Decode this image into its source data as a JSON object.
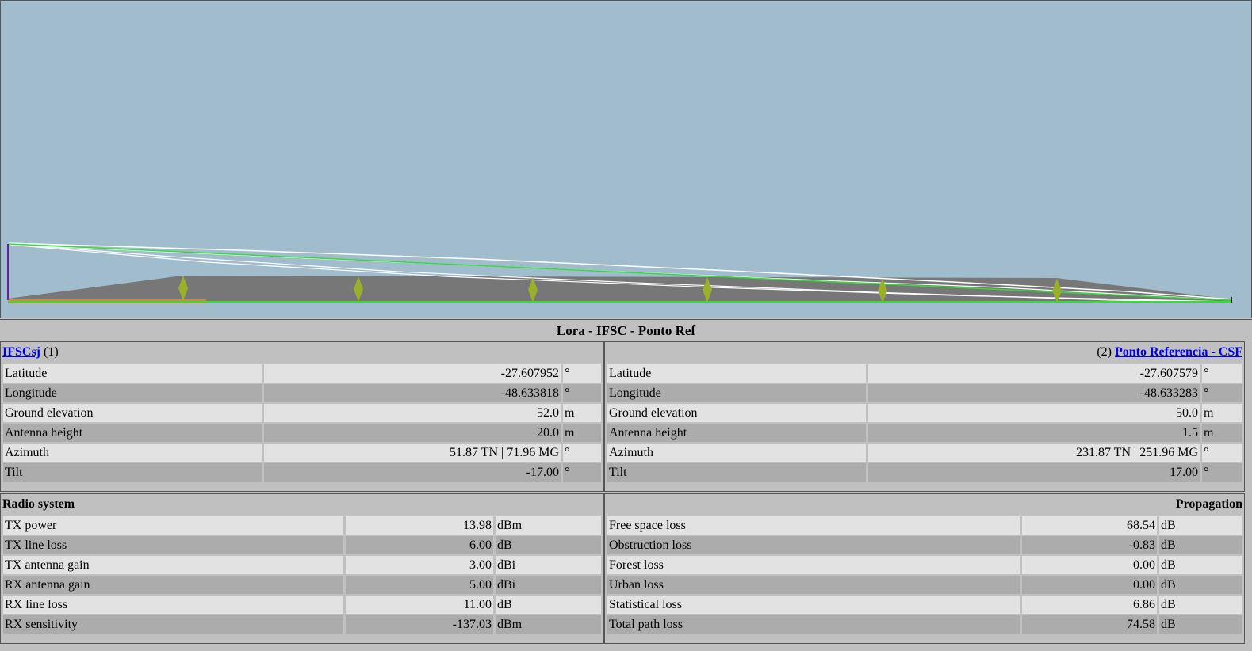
{
  "profile": {
    "sky_color": "#a0bccd",
    "terrain_color": "#777777",
    "ground_color": "#d08a3a",
    "fresnel_color": "#ffffff",
    "los_color": "#33dd33",
    "marker_color": "#9aaf2a",
    "tx_mast_color": "#6a1fa0"
  },
  "link_title": "Lora - IFSC - Ponto Ref",
  "site1": {
    "name": "IFSCsj",
    "index": "(1)",
    "rows": [
      {
        "label": "Latitude",
        "value": "-27.607952",
        "unit": "°"
      },
      {
        "label": "Longitude",
        "value": "-48.633818",
        "unit": "°"
      },
      {
        "label": "Ground elevation",
        "value": "52.0",
        "unit": "m"
      },
      {
        "label": "Antenna height",
        "value": "20.0",
        "unit": "m"
      },
      {
        "label": "Azimuth",
        "value": "51.87 TN | 71.96 MG",
        "unit": "°"
      },
      {
        "label": "Tilt",
        "value": "-17.00",
        "unit": "°"
      }
    ]
  },
  "site2": {
    "name": "Ponto Referencia - CSF",
    "index": "(2)",
    "rows": [
      {
        "label": "Latitude",
        "value": "-27.607579",
        "unit": "°"
      },
      {
        "label": "Longitude",
        "value": "-48.633283",
        "unit": "°"
      },
      {
        "label": "Ground elevation",
        "value": "50.0",
        "unit": "m"
      },
      {
        "label": "Antenna height",
        "value": "1.5",
        "unit": "m"
      },
      {
        "label": "Azimuth",
        "value": "231.87 TN | 251.96 MG",
        "unit": "°"
      },
      {
        "label": "Tilt",
        "value": "17.00",
        "unit": "°"
      }
    ]
  },
  "radio": {
    "heading": "Radio system",
    "rows": [
      {
        "label": "TX power",
        "value": "13.98",
        "unit": "dBm"
      },
      {
        "label": "TX line loss",
        "value": "6.00",
        "unit": "dB"
      },
      {
        "label": "TX antenna gain",
        "value": "3.00",
        "unit": "dBi"
      },
      {
        "label": "RX antenna gain",
        "value": "5.00",
        "unit": "dBi"
      },
      {
        "label": "RX line loss",
        "value": "11.00",
        "unit": "dB"
      },
      {
        "label": "RX sensitivity",
        "value": "-137.03",
        "unit": "dBm"
      }
    ]
  },
  "propagation": {
    "heading": "Propagation",
    "rows": [
      {
        "label": "Free space loss",
        "value": "68.54",
        "unit": "dB"
      },
      {
        "label": "Obstruction loss",
        "value": "-0.83",
        "unit": "dB"
      },
      {
        "label": "Forest loss",
        "value": "0.00",
        "unit": "dB"
      },
      {
        "label": "Urban loss",
        "value": "0.00",
        "unit": "dB"
      },
      {
        "label": "Statistical loss",
        "value": "6.86",
        "unit": "dB"
      },
      {
        "label": "Total path loss",
        "value": "74.58",
        "unit": "dB"
      }
    ]
  }
}
